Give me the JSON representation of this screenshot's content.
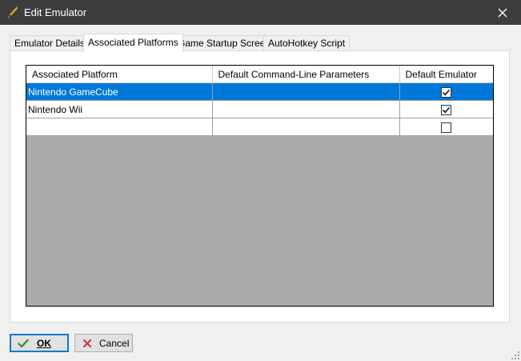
{
  "window": {
    "title": "Edit Emulator"
  },
  "tabs": [
    {
      "label": "Emulator Details",
      "active": false
    },
    {
      "label": "Associated Platforms",
      "active": true
    },
    {
      "label": "Game Startup Screen",
      "active": false
    },
    {
      "label": "AutoHotkey Script",
      "active": false
    }
  ],
  "grid": {
    "columns": [
      "Associated Platform",
      "Default Command-Line Parameters",
      "Default Emulator"
    ],
    "rows": [
      {
        "platform": "Nintendo GameCube",
        "params": "",
        "default_emulator": true,
        "selected": true
      },
      {
        "platform": "Nintendo Wii",
        "params": "",
        "default_emulator": true,
        "selected": false
      },
      {
        "platform": "",
        "params": "",
        "default_emulator": false,
        "selected": false
      }
    ]
  },
  "buttons": {
    "ok": {
      "label": "OK",
      "mnemonic": "O"
    },
    "cancel": {
      "label": "Cancel",
      "mnemonic": "C"
    }
  },
  "colors": {
    "titlebar": "#3d3d3d",
    "selection": "#0078d7",
    "grid_empty": "#ababab",
    "ok_check": "#2e9e2e",
    "cancel_x": "#d03a3a"
  }
}
